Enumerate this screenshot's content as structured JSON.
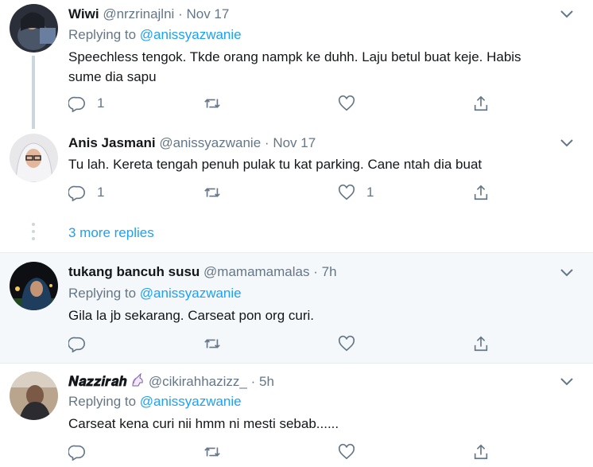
{
  "tweets": [
    {
      "name": "Wiwi",
      "handle": "@nrzrinajlni",
      "date": "Nov 17",
      "replying_label": "Replying to",
      "replying_to": "@anissyazwanie",
      "text_line1": "Speechless tengok. Tkde orang nampk ke duhh. Laju betul buat keje. Habis",
      "text_line2": "sume dia sapu",
      "reply_count": "1",
      "retweet_count": "",
      "like_count": ""
    },
    {
      "name": "Anis Jasmani",
      "handle": "@anissyazwanie",
      "date": "Nov 17",
      "text_line1": "Tu lah. Kereta tengah penuh pulak tu kat parking. Cane ntah dia buat",
      "reply_count": "1",
      "retweet_count": "",
      "like_count": "1"
    },
    {
      "name": "tukang bancuh susu",
      "handle": "@mamamamalas",
      "date": "7h",
      "replying_label": "Replying to",
      "replying_to": "@anissyazwanie",
      "text_line1": "Gila la jb sekarang. Carseat pon org curi.",
      "reply_count": "",
      "retweet_count": "",
      "like_count": ""
    },
    {
      "name": "𝑵𝒂𝒛𝒛𝒊𝒓𝒂𝒉",
      "handle": "@cikirahhazizz_",
      "date": "5h",
      "replying_label": "Replying to",
      "replying_to": "@anissyazwanie",
      "text_line1": "Carseat kena curi nii hmm ni mesti sebab......",
      "reply_count": "",
      "retweet_count": "",
      "like_count": ""
    }
  ],
  "more_replies": "3 more replies",
  "separator": "·",
  "colors": {
    "accent": "#1da1f2",
    "muted": "#657786",
    "highlight_bg": "#f5f8fa",
    "thread_line": "#ccd6dd"
  },
  "icons": [
    "reply-icon",
    "retweet-icon",
    "like-icon",
    "share-icon",
    "chevron-down-icon",
    "unicorn-icon"
  ]
}
